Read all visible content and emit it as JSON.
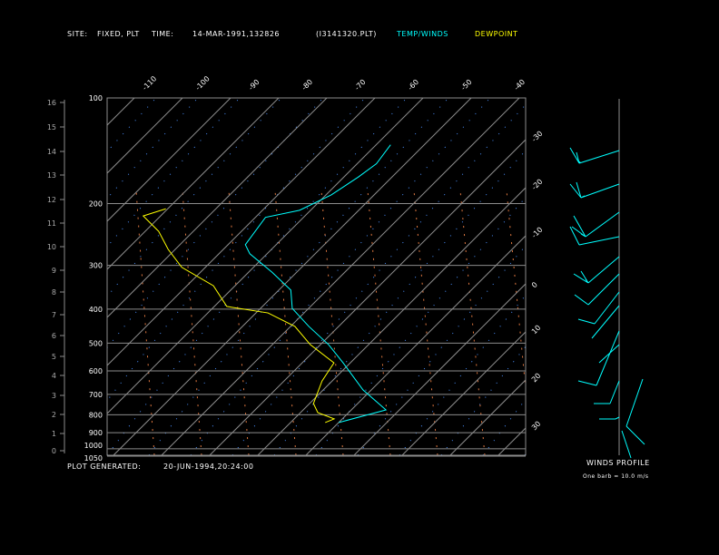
{
  "header": {
    "site_label": "SITE:",
    "site_value": "FIXED, PLT",
    "time_label": "TIME:",
    "time_value": "14-MAR-1991,132826",
    "file": "(I3141320.PLT)",
    "legend_temp": "TEMP/WINDS",
    "legend_dewpoint": "DEWPOINT"
  },
  "footer": {
    "generated_label": "PLOT GENERATED:",
    "generated_value": "20-JUN-1994,20:24:00"
  },
  "winds": {
    "title": "WINDS PROFILE",
    "note": "One barb = 10.0 m/s"
  },
  "colors": {
    "temp": "#00ffff",
    "dewpoint": "#ffff00",
    "grid": "#8c8c8c",
    "adiabat": "#4a90ff",
    "mixing": "#e07840"
  },
  "chart_data": {
    "type": "line",
    "subtype": "skew-t log-p",
    "pressure_ticks": [
      "100",
      "200",
      "300",
      "400",
      "500",
      "600",
      "700",
      "800",
      "900",
      "1000",
      "1050"
    ],
    "pressure_values": [
      100,
      200,
      300,
      400,
      500,
      600,
      700,
      800,
      900,
      1000,
      1050
    ],
    "height_ticks": [
      "0",
      "1",
      "2",
      "3",
      "4",
      "5",
      "6",
      "7",
      "8",
      "9",
      "10",
      "11",
      "12",
      "13",
      "14",
      "15",
      "16"
    ],
    "temp_ticks_top": [
      "-110",
      "-100",
      "-90",
      "-80",
      "-70",
      "-60",
      "-50",
      "-40"
    ],
    "temp_ticks_right": [
      "-30",
      "-20",
      "-10",
      "0",
      "10",
      "20",
      "30"
    ],
    "ylim_hpa": [
      1050,
      100
    ],
    "y_scale": "log",
    "grid": true,
    "series": [
      {
        "name": "TEMP/WINDS",
        "color": "#00ffff",
        "points": [
          [
            842,
            -10.0
          ],
          [
            775,
            -2.8
          ],
          [
            680,
            -11.7
          ],
          [
            569,
            -21.5
          ],
          [
            505,
            -28.3
          ],
          [
            448,
            -36.2
          ],
          [
            398,
            -43.4
          ],
          [
            353,
            -47.5
          ],
          [
            314,
            -55.1
          ],
          [
            278,
            -63.6
          ],
          [
            262,
            -66.4
          ],
          [
            219,
            -67.9
          ],
          [
            209,
            -62.3
          ],
          [
            189,
            -58.9
          ],
          [
            168,
            -57.0
          ],
          [
            154,
            -56.0
          ],
          [
            136,
            -57.0
          ]
        ]
      },
      {
        "name": "DEWPOINT",
        "color": "#ffff00",
        "points": [
          [
            842,
            -12.8
          ],
          [
            822,
            -11.7
          ],
          [
            789,
            -16.4
          ],
          [
            743,
            -19.2
          ],
          [
            641,
            -22.1
          ],
          [
            569,
            -23.4
          ],
          [
            505,
            -32.1
          ],
          [
            448,
            -39.1
          ],
          [
            410,
            -47.5
          ],
          [
            393,
            -57.4
          ],
          [
            343,
            -64.5
          ],
          [
            304,
            -74.9
          ],
          [
            270,
            -81.5
          ],
          [
            240,
            -87.2
          ],
          [
            217,
            -93.6
          ],
          [
            207,
            -90.4
          ]
        ]
      }
    ]
  }
}
